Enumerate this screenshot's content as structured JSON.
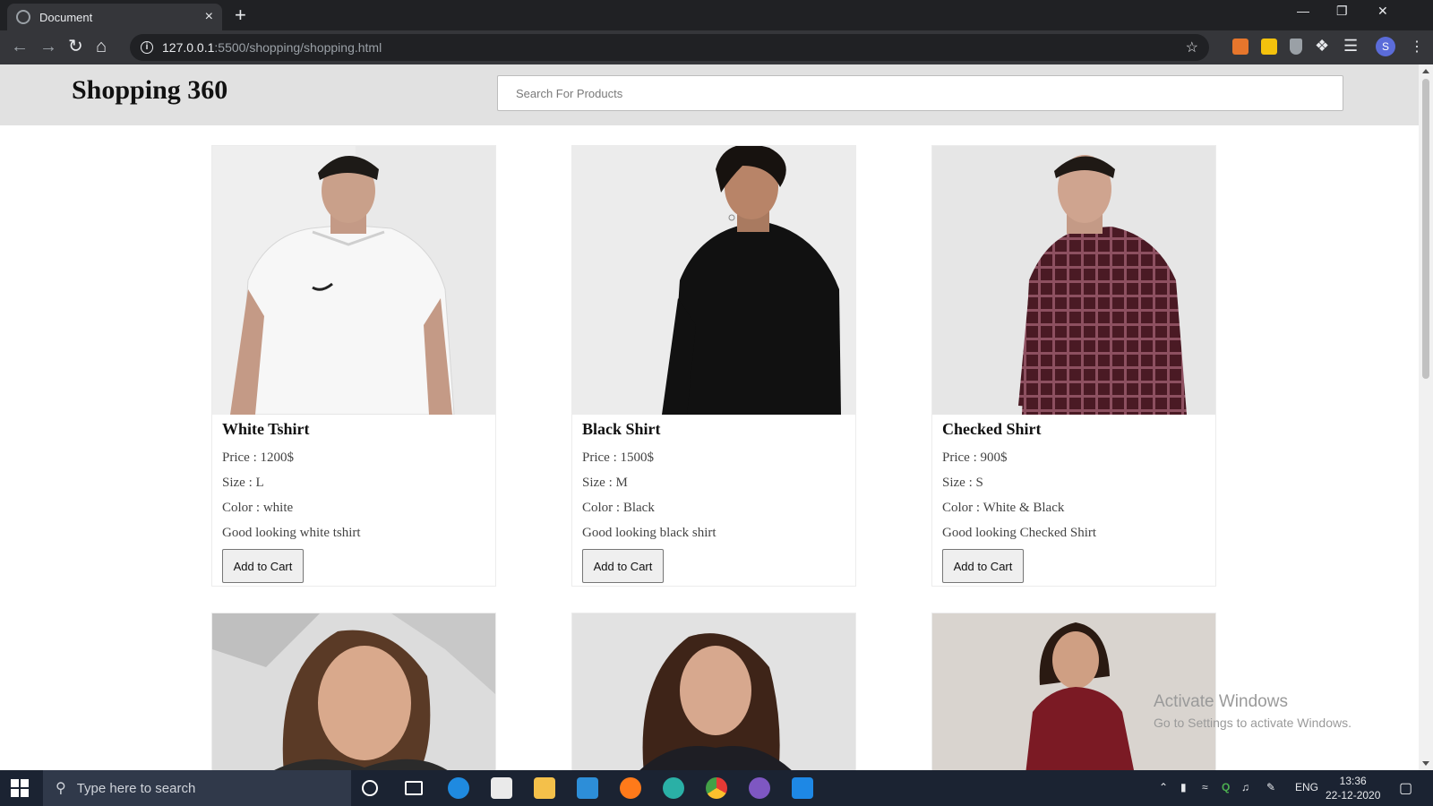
{
  "browser": {
    "tab_title": "Document",
    "tab_close": "×",
    "new_tab": "+",
    "url_host": "127.0.0.1",
    "url_path": ":5500/shopping/shopping.html",
    "profile_initial": "S"
  },
  "site": {
    "logo": "Shopping 360",
    "search_placeholder": "Search For Products"
  },
  "products": [
    {
      "name": "White Tshirt",
      "price": "Price : 1200$",
      "size": "Size : L",
      "color": "Color : white",
      "desc": "Good looking white tshirt",
      "button": "Add to Cart"
    },
    {
      "name": "Black Shirt",
      "price": "Price : 1500$",
      "size": "Size : M",
      "color": "Color : Black",
      "desc": "Good looking black shirt",
      "button": "Add to Cart"
    },
    {
      "name": "Checked Shirt",
      "price": "Price : 900$",
      "size": "Size : S",
      "color": "Color : White & Black",
      "desc": "Good looking Checked Shirt",
      "button": "Add to Cart"
    }
  ],
  "watermark": {
    "line1": "Activate Windows",
    "line2": "Go to Settings to activate Windows."
  },
  "taskbar": {
    "search_text": "Type here to search",
    "language": "ENG",
    "time": "13:36",
    "date": "22-12-2020"
  },
  "colors": {
    "browser_dark": "#202124",
    "toolbar": "#35363a",
    "site_header": "#e1e1e1",
    "taskbar": "#1b2332"
  }
}
